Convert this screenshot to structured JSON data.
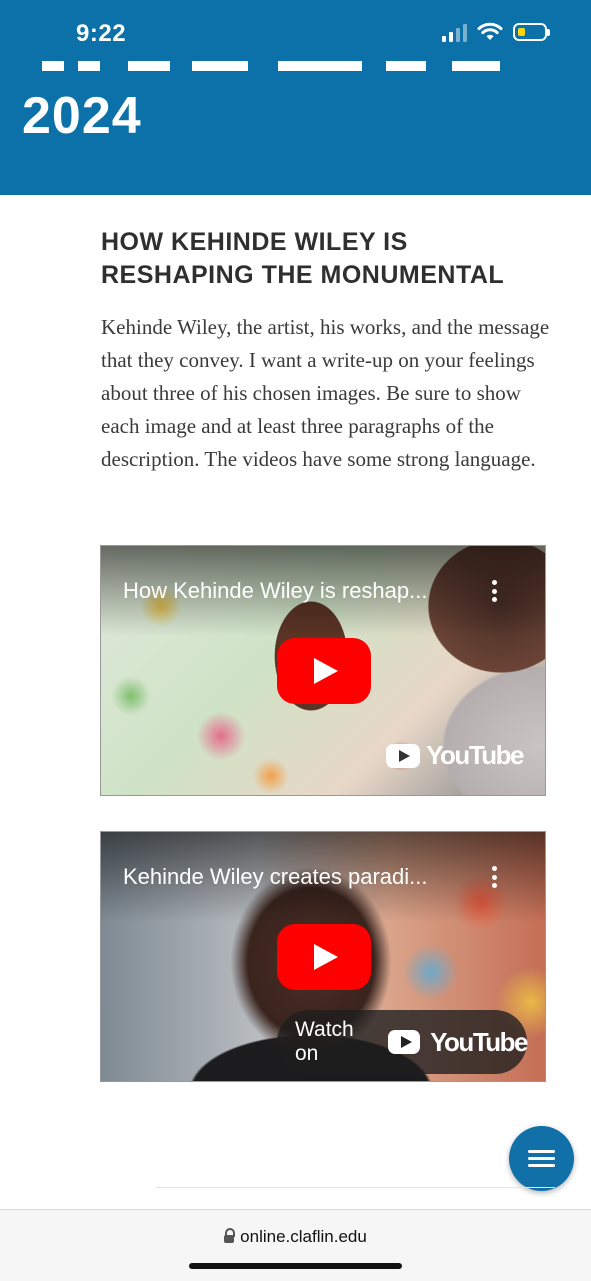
{
  "status_bar": {
    "time": "9:22",
    "icons": [
      "cellular-signal-icon",
      "wifi-icon",
      "battery-low-icon"
    ]
  },
  "header": {
    "year": "2024",
    "background_color": "#0b71a8"
  },
  "article": {
    "title": "HOW KEHINDE WILEY IS RESHAPING THE MONUMENTAL",
    "body": "Kehinde Wiley, the artist, his works, and the message that they convey. I want a write-up on your feelings about three of his chosen images. Be sure to show each image and at least three paragraphs of the description. The videos have some strong language."
  },
  "videos": [
    {
      "title": "How Kehinde Wiley is reshap...",
      "brand": "YouTube",
      "icons": [
        "more-vert-icon",
        "play-icon",
        "youtube-logo-icon"
      ]
    },
    {
      "title": "Kehinde Wiley creates paradi...",
      "watch_label": "Watch on",
      "brand": "YouTube",
      "icons": [
        "more-vert-icon",
        "play-icon",
        "youtube-logo-icon"
      ]
    }
  ],
  "fab": {
    "icon": "menu-icon",
    "color": "#1170a8"
  },
  "browser": {
    "url": "online.claflin.edu",
    "icon": "lock-icon"
  }
}
